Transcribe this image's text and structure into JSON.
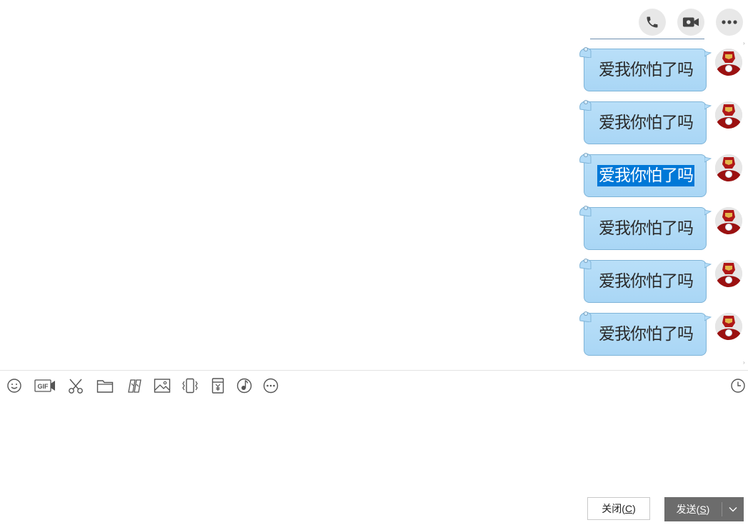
{
  "header": {
    "actions": [
      {
        "name": "voice-call",
        "icon": "phone-icon"
      },
      {
        "name": "video-call",
        "icon": "video-camera-icon"
      },
      {
        "name": "more",
        "icon": "more-dots-icon"
      }
    ]
  },
  "messages": [
    {
      "text": "爱我你怕了吗",
      "selected": false
    },
    {
      "text": "爱我你怕了吗",
      "selected": false
    },
    {
      "text": "爱我你怕了吗",
      "selected": true
    },
    {
      "text": "爱我你怕了吗",
      "selected": false
    },
    {
      "text": "爱我你怕了吗",
      "selected": false
    },
    {
      "text": "爱我你怕了吗",
      "selected": false
    }
  ],
  "toolbar": {
    "tools": [
      "emoji-icon",
      "gif-icon",
      "scissors-icon",
      "folder-icon",
      "graffiti-icon",
      "image-icon",
      "shake-icon",
      "red-packet-icon",
      "music-icon",
      "more-circle-icon"
    ],
    "gif_label": "GIF",
    "history_icon": "clock-icon"
  },
  "input": {
    "value": ""
  },
  "buttons": {
    "close_text": "关闭(",
    "close_key": "C",
    "close_end": ")",
    "send_text": "发送(",
    "send_key": "S",
    "send_end": ")"
  },
  "colors": {
    "bubble": "#b2dbf7",
    "bubble_border": "#7fb4d8",
    "selection": "#0078d7",
    "send_button": "#6c6c6c",
    "round_button": "#e8e8e8"
  }
}
